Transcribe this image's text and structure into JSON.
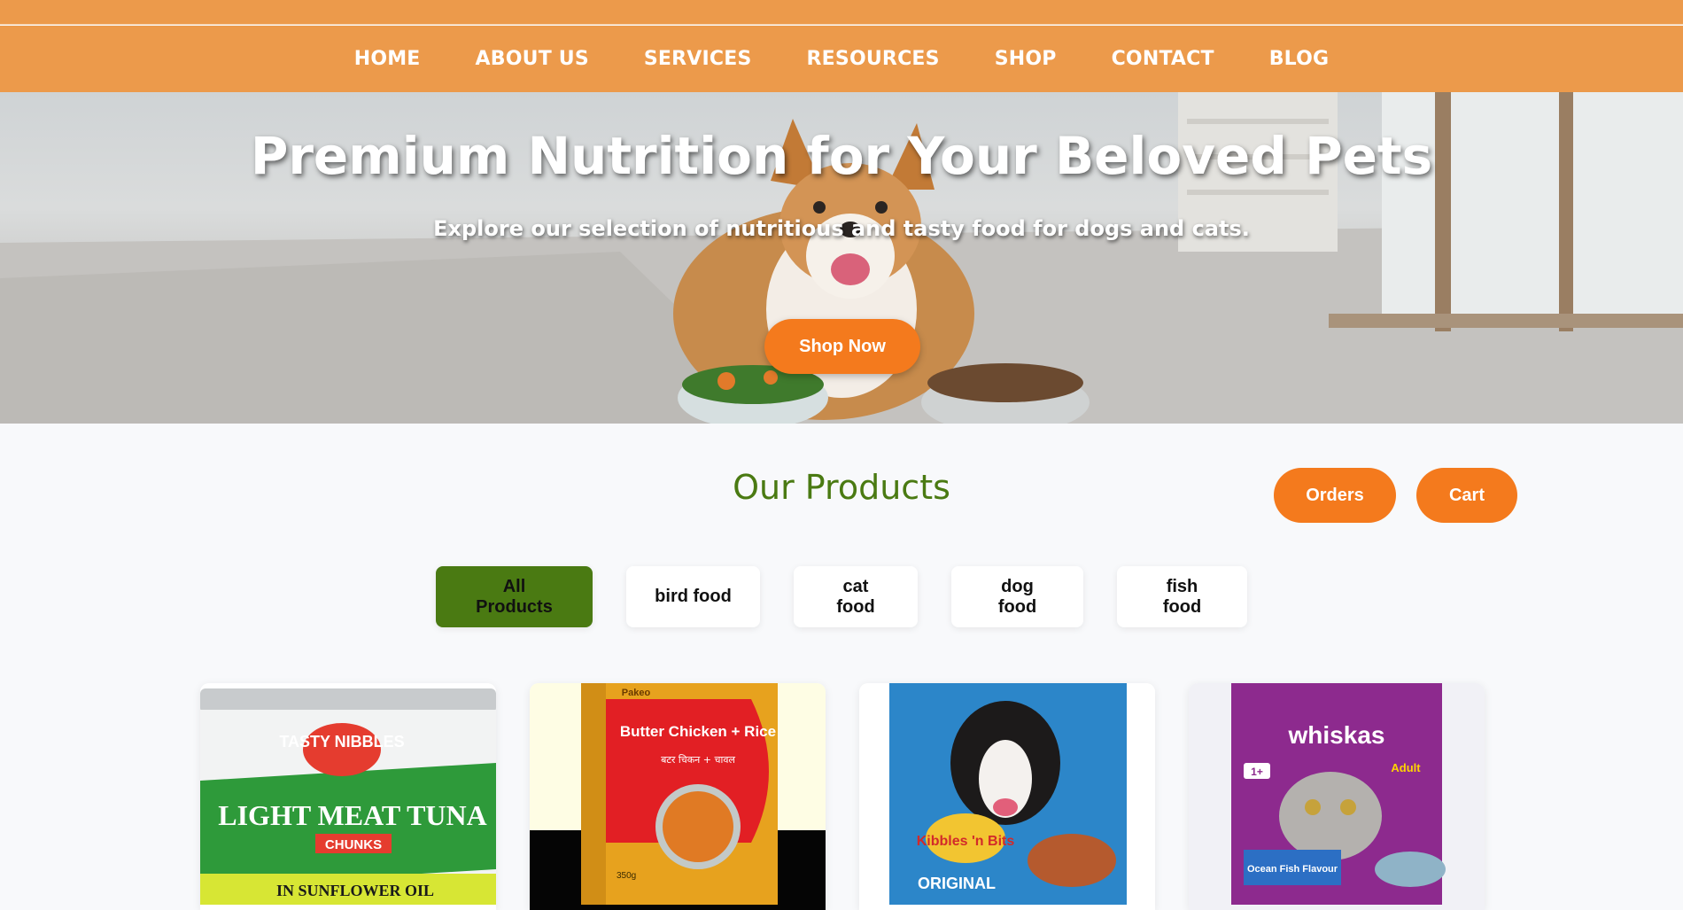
{
  "nav": {
    "items": [
      "HOME",
      "ABOUT US",
      "SERVICES",
      "RESOURCES",
      "SHOP",
      "CONTACT",
      "BLOG"
    ]
  },
  "hero": {
    "title": "Premium Nutrition for Your Beloved Pets",
    "subtitle": "Explore our selection of nutritious and tasty food for dogs and cats.",
    "cta": "Shop Now"
  },
  "products_section": {
    "title": "Our Products",
    "orders_label": "Orders",
    "cart_label": "Cart",
    "filters": [
      "All Products",
      "bird food",
      "cat food",
      "dog food",
      "fish food"
    ],
    "active_filter": "All Products"
  },
  "products": [
    {
      "brand": "TASTY NIBBLES",
      "name": "LIGHT MEAT TUNA",
      "tag": "CHUNKS",
      "line": "IN SUNFLOWER OIL",
      "icon": "tuna-can-image"
    },
    {
      "brand": "Pakeo",
      "name": "Butter Chicken + Rice",
      "tag": "बटर चिकन + चावल",
      "line": "350g",
      "icon": "butter-chicken-box-image"
    },
    {
      "brand": "Kibbles 'n Bits",
      "name": "ORIGINAL",
      "tag": "",
      "line": "",
      "icon": "dog-food-bag-image"
    },
    {
      "brand": "whiskas",
      "name": "Ocean Fish Flavour",
      "tag": "Adult",
      "line": "1+",
      "icon": "cat-food-bag-image"
    }
  ],
  "colors": {
    "nav_bg": "#ec9a4b",
    "accent": "#f47a1d",
    "green": "#4a7a12"
  }
}
